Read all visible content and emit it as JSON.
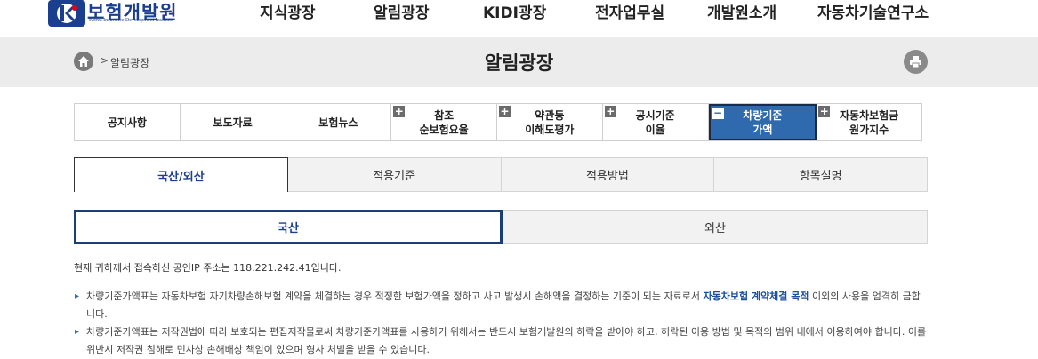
{
  "header": {
    "logo_name": "보험개발원",
    "logo_sub": "Korea Insurance Development Institute",
    "nav": [
      "지식광장",
      "알림광장",
      "KIDI광장",
      "전자업무실",
      "개발원소개",
      "자동차기술연구소"
    ]
  },
  "titlebar": {
    "breadcrumb_sep": ">",
    "breadcrumb": "알림광장",
    "page_title": "알림광장"
  },
  "menu": {
    "items": [
      {
        "line1": "공지사항",
        "line2": "",
        "plus": ""
      },
      {
        "line1": "보도자료",
        "line2": "",
        "plus": ""
      },
      {
        "line1": "보험뉴스",
        "line2": "",
        "plus": ""
      },
      {
        "line1": "참조",
        "line2": "순보험요율",
        "plus": "+"
      },
      {
        "line1": "약관등",
        "line2": "이해도평가",
        "plus": "+"
      },
      {
        "line1": "공시기준",
        "line2": "이율",
        "plus": "+"
      },
      {
        "line1": "차량기준",
        "line2": "가액",
        "plus": "−"
      },
      {
        "line1": "자동차보험금",
        "line2": "원가지수",
        "plus": "+"
      }
    ]
  },
  "tabs1": [
    "국산/외산",
    "적용기준",
    "적용방법",
    "항목설명"
  ],
  "tabs2": [
    "국산",
    "외산"
  ],
  "ip_notice": "현재 귀하께서 접속하신 공인IP 주소는 118.221.242.41입니다.",
  "notes": {
    "note1_a": "차량기준가액표는 자동차보험 자기차량손해보험 계약을 체결하는 경우 적정한 보험가액을 정하고 사고 발생시 손해액을 결정하는 기준이 되는 자료로서 ",
    "note1_hl": "자동차보험 계약체결 목적",
    "note1_b": " 이외의 사용을 엄격히 금합니다.",
    "note2": "차량기준가액표는 저작권법에 따라 보호되는 편집저작물로써 차량기준가액표를 사용하기 위해서는 반드시 보험개발원의 허락을 받아야 하고, 허락된 이용 방법 및 목적의 범위 내에서 이용하여야 합니다. 이를 위반시 저작권 침해로 민사상 손해배상 책임이 있으며 형사 처벌을 받을 수 있습니다."
  },
  "colors": {
    "brand": "#1b3f8f",
    "active_menu": "#2e6aad",
    "accent_red": "#e60012"
  }
}
